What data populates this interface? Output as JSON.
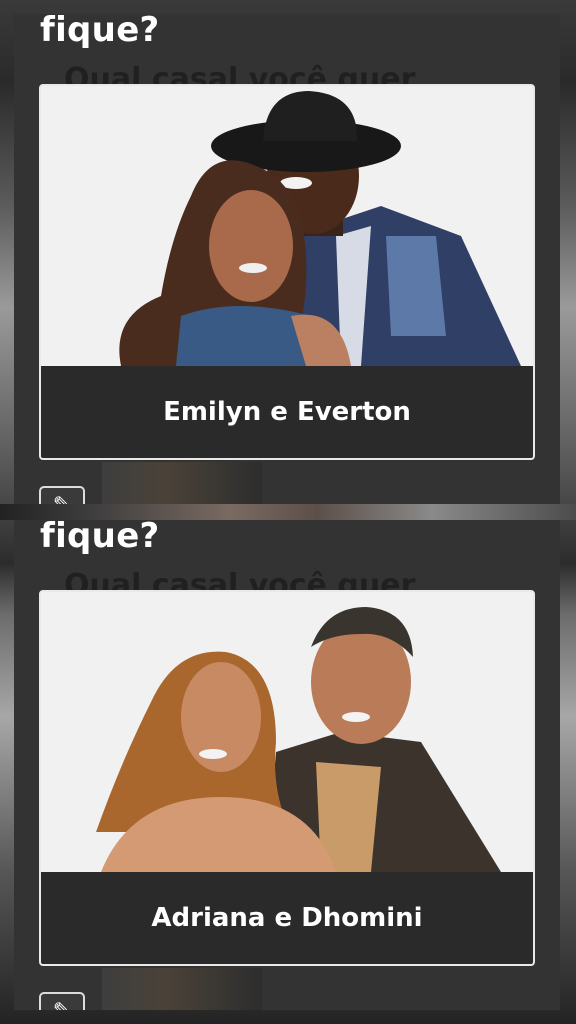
{
  "screens": [
    {
      "question_visible": "fique?",
      "question_ghost": "Qual casal você quer",
      "option_label": "Emilyn e Everton",
      "edit_icon": "pencil-icon"
    },
    {
      "question_visible": "fique?",
      "question_ghost": "Qual casal você quer",
      "option_label": "Adriana e Dhomini",
      "edit_icon": "pencil-icon"
    }
  ],
  "colors": {
    "panel_bg": "#333333",
    "label_bar_bg": "#2a2a2a",
    "card_border": "#e9e9e9",
    "text_primary": "#ffffff"
  }
}
